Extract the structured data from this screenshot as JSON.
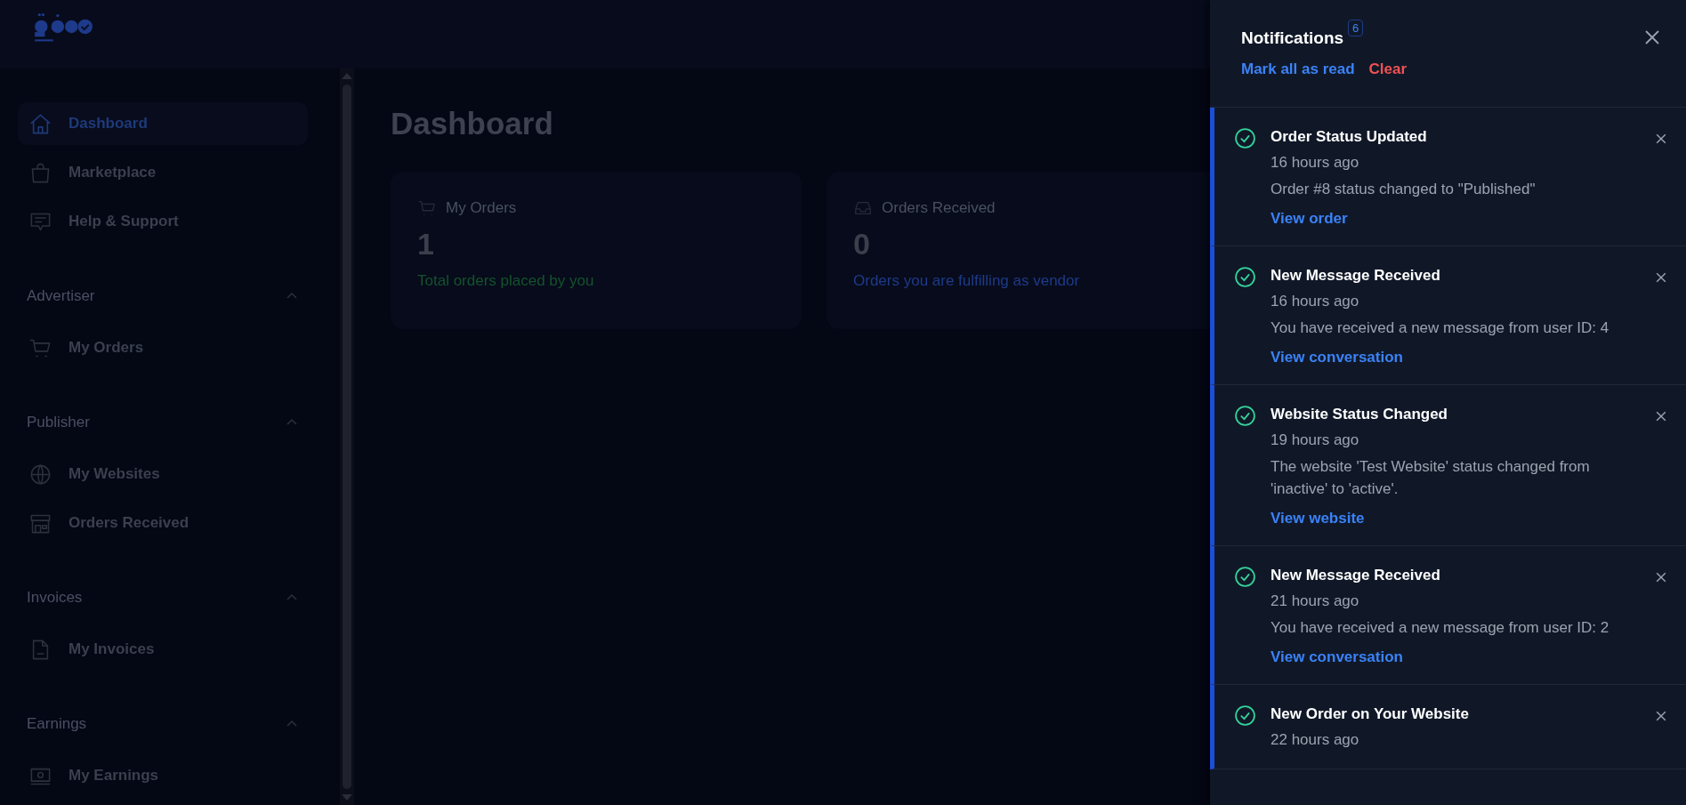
{
  "sidebar": {
    "items": [
      {
        "label": "Dashboard",
        "kind": "home",
        "selected": true
      },
      {
        "label": "Marketplace",
        "kind": "bag",
        "selected": false
      },
      {
        "label": "Help & Support",
        "kind": "chat",
        "selected": false
      }
    ],
    "sections": [
      {
        "title": "Advertiser",
        "expanded": true,
        "items": [
          {
            "label": "My Orders",
            "kind": "cart",
            "selected": false
          }
        ]
      },
      {
        "title": "Publisher",
        "expanded": true,
        "items": [
          {
            "label": "My Websites",
            "kind": "globe",
            "selected": false
          },
          {
            "label": "Orders Received",
            "kind": "store",
            "selected": false
          }
        ]
      },
      {
        "title": "Invoices",
        "expanded": true,
        "items": [
          {
            "label": "My Invoices",
            "kind": "file",
            "selected": false
          }
        ]
      },
      {
        "title": "Earnings",
        "expanded": true,
        "items": [
          {
            "label": "My Earnings",
            "kind": "cash",
            "selected": false
          }
        ]
      }
    ]
  },
  "page": {
    "title": "Dashboard",
    "cards": [
      {
        "label": "My Orders",
        "kind": "cart",
        "value": "1",
        "caption": "Total orders placed by you",
        "color": "#14532d"
      },
      {
        "label": "Orders Received",
        "kind": "inbox",
        "value": "0",
        "caption": "Orders you are fulfilling as vendor",
        "color": "#1e3a8a"
      }
    ]
  },
  "notifications": {
    "title": "Notifications",
    "count": "6",
    "mark_all": "Mark all as read",
    "clear": "Clear",
    "items": [
      {
        "title": "Order Status Updated",
        "time": "16 hours ago",
        "message": "Order #8 status changed to \"Published\"",
        "link": "View order",
        "unread": true
      },
      {
        "title": "New Message Received",
        "time": "16 hours ago",
        "message": "You have received a new message from user ID: 4",
        "link": "View conversation",
        "unread": true
      },
      {
        "title": "Website Status Changed",
        "time": "19 hours ago",
        "message": "The website 'Test Website' status changed from 'inactive' to 'active'.",
        "link": "View website",
        "unread": true
      },
      {
        "title": "New Message Received",
        "time": "21 hours ago",
        "message": "You have received a new message from user ID: 2",
        "link": "View conversation",
        "unread": true
      },
      {
        "title": "New Order on Your Website",
        "time": "22 hours ago",
        "unread": true
      }
    ]
  }
}
